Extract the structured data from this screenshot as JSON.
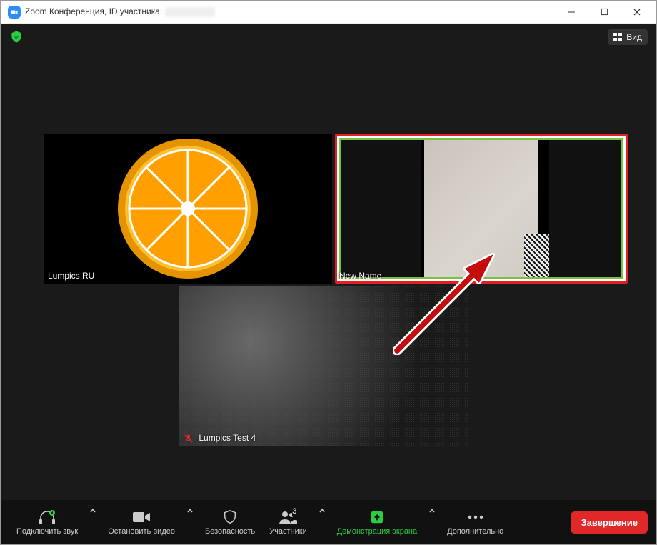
{
  "window": {
    "title_prefix": "Zoom Конференция, ID участника:"
  },
  "topbar": {
    "view_label": "Вид"
  },
  "participants": {
    "tile1_name": "Lumpics RU",
    "tile2_name": "New Name",
    "tile3_name": "Lumpics Test 4"
  },
  "toolbar": {
    "audio": "Подключить звук",
    "video": "Остановить видео",
    "security": "Безопасность",
    "participants": "Участники",
    "participants_count": "3",
    "share": "Демонстрация экрана",
    "more": "Дополнительно",
    "end": "Завершение"
  }
}
